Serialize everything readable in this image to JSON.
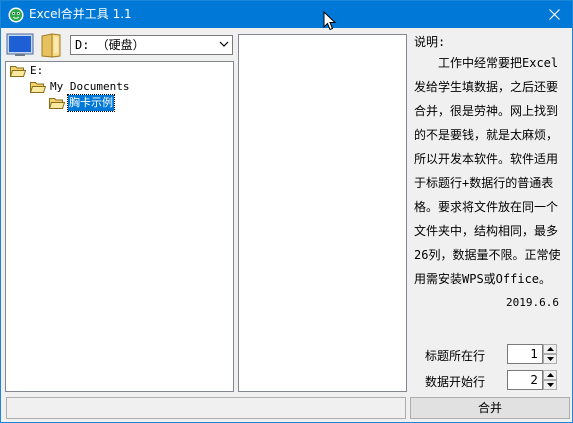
{
  "window": {
    "title": "Excel合并工具 1.1"
  },
  "icons": {
    "app": "app-logo-icon",
    "close": "close-icon",
    "monitor": "monitor-icon",
    "folder": "folder-icon",
    "cursor": "mouse-cursor-icon"
  },
  "drive_select": {
    "value": "D: （硬盘）"
  },
  "tree": {
    "nodes": [
      {
        "label": "E:"
      },
      {
        "label": "My Documents"
      },
      {
        "label": "胸卡示例"
      }
    ]
  },
  "description": {
    "title": "说明:",
    "body": "工作中经常要把Excel发给学生填数据，之后还要合并，很是劳神。网上找到的不是要钱，就是太麻烦，所以开发本软件。软件适用于标题行+数据行的普通表格。要求将文件放在同一个文件夹中，结构相同，最多26列，数据量不限。正常使用需安装WPS或Office。",
    "date": "2019.6.6"
  },
  "settings": {
    "title_row": {
      "label": "标题所在行",
      "value": "1"
    },
    "data_start_row": {
      "label": "数据开始行",
      "value": "2"
    }
  },
  "buttons": {
    "merge": "合并"
  },
  "status": {
    "text": ""
  },
  "colors": {
    "titlebar": "#0078d7",
    "selection": "#0078d7",
    "folder": "#f2d36b"
  }
}
